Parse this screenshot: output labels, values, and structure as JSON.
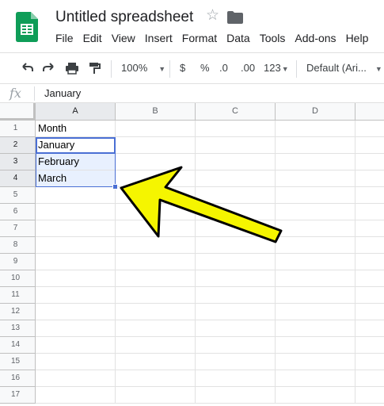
{
  "header": {
    "title": "Untitled spreadsheet",
    "menu": [
      "File",
      "Edit",
      "View",
      "Insert",
      "Format",
      "Data",
      "Tools",
      "Add-ons",
      "Help"
    ]
  },
  "toolbar": {
    "zoom": "100%",
    "currency": "$",
    "percent": "%",
    "decrease_decimal": ".0",
    "increase_decimal": ".00",
    "more_formats": "123",
    "font": "Default (Ari..."
  },
  "formula_bar": {
    "fx_label": "fx",
    "value": "January"
  },
  "grid": {
    "columns": [
      "A",
      "B",
      "C",
      "D"
    ],
    "rows": [
      "1",
      "2",
      "3",
      "4",
      "5",
      "6",
      "7",
      "8",
      "9",
      "10",
      "11",
      "12",
      "13",
      "14",
      "15",
      "16",
      "17"
    ],
    "cells": {
      "A1": "Month",
      "A2": "January",
      "A3": "February",
      "A4": "March"
    }
  },
  "colors": {
    "selection_border": "#4a6fd4",
    "selection_fill": "#e8f0fe",
    "arrow_fill": "#f5f500",
    "logo_green": "#0f9d58"
  }
}
